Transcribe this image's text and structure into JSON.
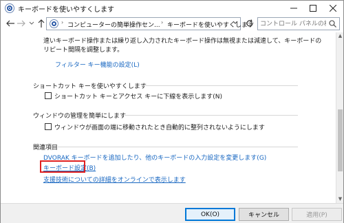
{
  "window": {
    "title": "キーボードを使いやすくします"
  },
  "navigation": {
    "breadcrumb": [
      "コンピューターの簡単操作セン...",
      "キーボードを使いやすくします"
    ],
    "search_placeholder": "コントロール パネルの検索"
  },
  "content": {
    "intro_text": "速いキーボード操作または繰り返し入力されたキーボード操作は無視または減速して、キーボードのリピート間隔を調整します。",
    "filter_link": "フィルター キー機能の設定(L)",
    "shortcut_section": {
      "title": "ショートカット キーを使いやすくします",
      "checkbox_label": "ショートカット キーとアクセス キーに下線を表示します(N)"
    },
    "window_section": {
      "title": "ウィンドウの管理を簡単にします",
      "checkbox_label": "ウィンドウが画面の端に移動されたとき自動的に整列されないようにします"
    },
    "related_section": {
      "title": "関連項目",
      "links": [
        "DVORAK キーボードを追加したり、他のキーボードの入力設定を変更します(G)",
        "キーボード設定(B)",
        "支援技術についての詳細をオンラインで表示します"
      ]
    }
  },
  "footer": {
    "ok_label": "OK(O)",
    "cancel_label": "キャンセル",
    "apply_label": "適用(P)"
  },
  "colors": {
    "link": "#1565c0",
    "highlight": "#e02020",
    "ok_border": "#0078d7"
  }
}
